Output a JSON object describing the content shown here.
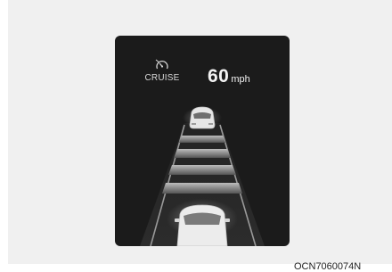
{
  "cluster": {
    "cruise_label": "CRUISE",
    "speed_value": "60",
    "speed_unit": "mph",
    "icon": "cruise-speedometer-icon"
  },
  "figure_code": "OCN7060074N",
  "colors": {
    "screen_background": "#1b1b1b",
    "figure_background": "#f0f0f0",
    "text": "#f2f2f2"
  }
}
